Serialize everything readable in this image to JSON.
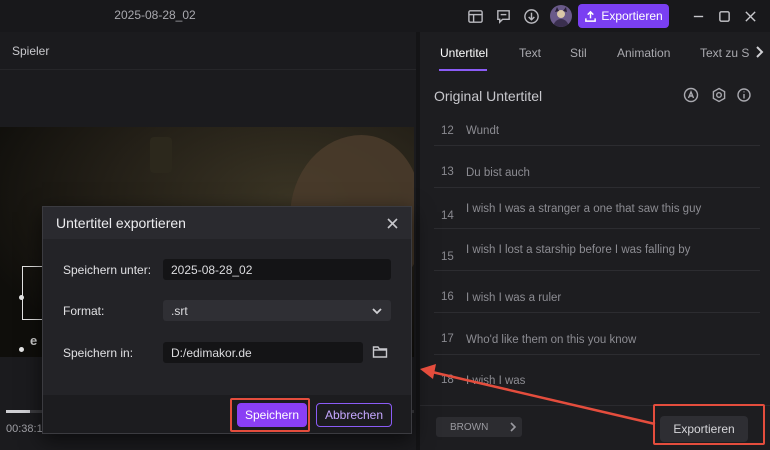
{
  "titlebar": {
    "document_title": "2025-08-28_02",
    "export_label": "Exportieren",
    "icons": [
      "layout-icon",
      "feedback-icon",
      "download-icon",
      "avatar",
      "upload-icon",
      "minimize-icon",
      "maximize-icon",
      "close-icon"
    ]
  },
  "player": {
    "title": "Spieler",
    "watermark": "e",
    "time": "00:38:1",
    "progress": 0.06
  },
  "panel": {
    "tabs": [
      "Untertitel",
      "Text",
      "Stil",
      "Animation",
      "Text zu S"
    ],
    "active_tab": "Untertitel",
    "title": "Original Untertitel",
    "subtitles": [
      {
        "num": "12",
        "text": "Wundt"
      },
      {
        "num": "13",
        "text": "Du bist auch"
      },
      {
        "num": "14",
        "text": "I wish I was a stranger  a one that saw this guy"
      },
      {
        "num": "15",
        "text": "I wish I lost a starship before I was falling by"
      },
      {
        "num": "16",
        "text": "I wish I was a ruler"
      },
      {
        "num": "17",
        "text": "Who'd like them on this  you know"
      },
      {
        "num": "18",
        "text": "I wish I was"
      }
    ],
    "style_chip": "BROWN",
    "export_label": "Exportieren"
  },
  "dialog": {
    "title": "Untertitel exportieren",
    "save_as_label": "Speichern unter:",
    "save_as_value": "2025-08-28_02",
    "format_label": "Format:",
    "format_value": ".srt",
    "save_in_label": "Speichern in:",
    "save_in_value": "D:/edimakor.de",
    "save_button": "Speichern",
    "cancel_button": "Abbrechen"
  },
  "colors": {
    "accent": "#8a3ff5",
    "highlight": "#e44d3d"
  }
}
